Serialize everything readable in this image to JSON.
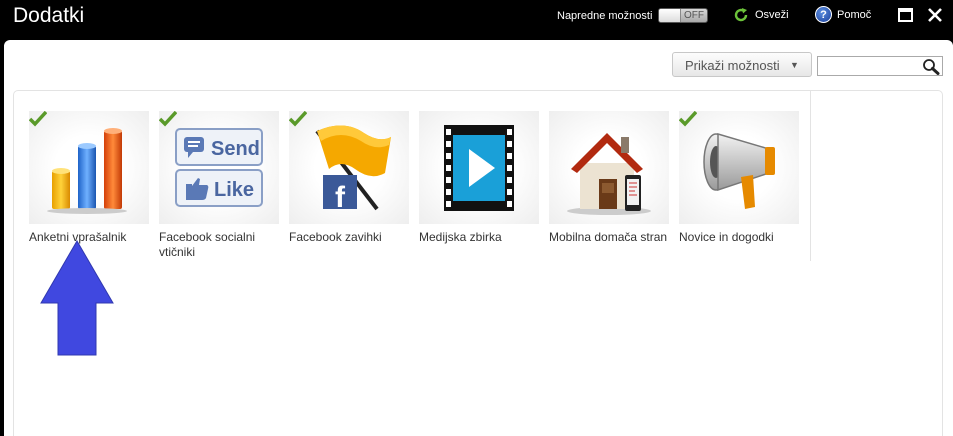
{
  "window": {
    "title": "Dodatki",
    "advanced_label": "Napredne možnosti",
    "toggle_state": "OFF",
    "refresh_label": "Osveži",
    "help_label": "Pomoč",
    "help_glyph": "?"
  },
  "toolbar": {
    "show_options_label": "Prikaži možnosti",
    "dropdown_arrow": "▼",
    "search_placeholder": "",
    "search_value": ""
  },
  "addons": [
    {
      "label": "Anketni vprašalnik",
      "installed": true,
      "icon": "bar-chart-icon"
    },
    {
      "label": "Facebook socialni vtičniki",
      "installed": true,
      "icon": "facebook-send-like-icon",
      "send_text": "Send",
      "like_text": "Like"
    },
    {
      "label": "Facebook zavihki",
      "installed": true,
      "icon": "facebook-flag-icon",
      "glyph": "f"
    },
    {
      "label": "Medijska zbirka",
      "installed": false,
      "icon": "film-strip-icon"
    },
    {
      "label": "Mobilna domača stran",
      "installed": false,
      "icon": "house-phone-icon"
    },
    {
      "label": "Novice in dogodki",
      "installed": true,
      "icon": "megaphone-icon"
    }
  ],
  "colors": {
    "check_green": "#5a9a2a",
    "annotation_arrow": "#4048e0",
    "titlebar": "#000000"
  }
}
